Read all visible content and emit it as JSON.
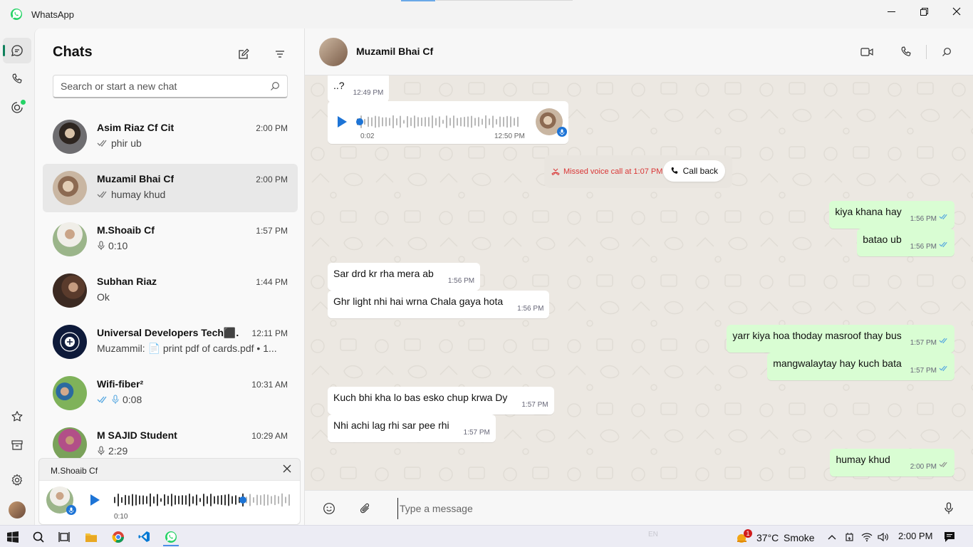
{
  "window": {
    "title": "WhatsApp"
  },
  "sidebar": {
    "title": "Chats",
    "search_placeholder": "Search or start a new chat",
    "chats": [
      {
        "name": "Asim Riaz Cf Cit",
        "time": "2:00 PM",
        "preview": "phir ub",
        "status": "read-gray"
      },
      {
        "name": "Muzamil Bhai Cf",
        "time": "2:00 PM",
        "preview": "humay khud",
        "status": "read-gray",
        "active": true
      },
      {
        "name": "M.Shoaib Cf",
        "time": "1:57 PM",
        "preview": "0:10",
        "status": "voice"
      },
      {
        "name": "Subhan Riaz",
        "time": "1:44 PM",
        "preview": "Ok",
        "status": "none"
      },
      {
        "name": "Universal Developers Tech⬛...",
        "time": "12:11 PM",
        "preview": "Muzammil: 📄 print pdf of cards.pdf • 1...",
        "status": "none"
      },
      {
        "name": "Wifi-fiber²",
        "time": "10:31 AM",
        "preview": "0:08",
        "status": "read-blue-voice"
      },
      {
        "name": "M SAJID Student",
        "time": "10:29 AM",
        "preview": "2:29",
        "status": "voice"
      }
    ],
    "player": {
      "name": "M.Shoaib Cf",
      "duration": "0:10",
      "progress": 0.73
    }
  },
  "chat": {
    "contact": "Muzamil Bhai Cf",
    "messages": [
      {
        "dir": "in",
        "text": "..?",
        "time": "12:49 PM"
      },
      {
        "dir": "voice",
        "duration": "0:02",
        "time": "12:50 PM"
      },
      {
        "dir": "system",
        "text": "Missed voice call at 1:07 PM",
        "action": "Call back"
      },
      {
        "dir": "out",
        "text": "kiya khana hay",
        "time": "1:56 PM"
      },
      {
        "dir": "out",
        "text": "batao ub",
        "time": "1:56 PM"
      },
      {
        "dir": "in",
        "text": "Sar drd kr rha mera ab",
        "time": "1:56 PM"
      },
      {
        "dir": "in",
        "text": "Ghr light nhi hai wrna Chala gaya hota",
        "time": "1:56 PM"
      },
      {
        "dir": "out",
        "text": "yarr kiya hoa thoday masroof thay bus",
        "time": "1:57 PM"
      },
      {
        "dir": "out",
        "text": "mangwalaytay hay kuch bata",
        "time": "1:57 PM"
      },
      {
        "dir": "in",
        "text": "Kuch bhi kha lo bas esko chup krwa Dy",
        "time": "1:57 PM"
      },
      {
        "dir": "in",
        "text": "Nhi achi lag rhi sar pee rhi",
        "time": "1:57 PM"
      },
      {
        "dir": "out",
        "text": "humay khud",
        "time": "2:00 PM"
      }
    ],
    "composer_placeholder": "Type a message"
  },
  "taskbar": {
    "lang": "EN",
    "weather": "37°C",
    "weather_desc": "Smoke",
    "clock": "2:00 PM",
    "weather_badge": "1"
  },
  "colors": {
    "accent": "#10805c",
    "outgoing": "#d9fdd3",
    "read_tick": "#53a6e0",
    "missed": "#d93636"
  }
}
